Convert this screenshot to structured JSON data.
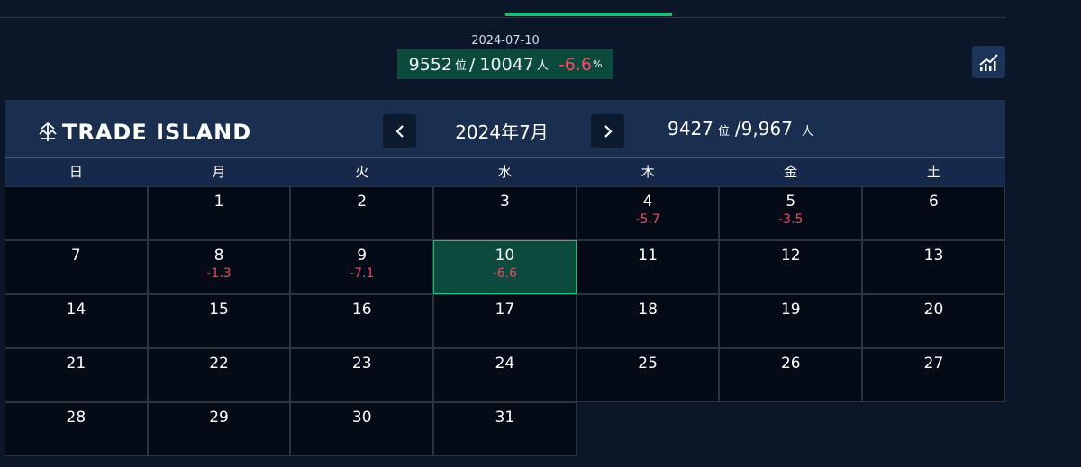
{
  "summary": {
    "date": "2024-07-10",
    "rank": "9552",
    "rank_unit": "位",
    "separator": "/",
    "total": "10047",
    "total_unit": "人",
    "change": "-6.6",
    "change_unit": "%"
  },
  "calendar": {
    "brand": "TRADE ISLAND",
    "month": "2024年7月",
    "rank": "9427",
    "rank_unit": "位",
    "total": "/9,967",
    "total_unit": "人",
    "weekdays": [
      "日",
      "月",
      "火",
      "水",
      "木",
      "金",
      "土"
    ],
    "days": [
      {
        "day": "",
        "val": ""
      },
      {
        "day": "1",
        "val": ""
      },
      {
        "day": "2",
        "val": ""
      },
      {
        "day": "3",
        "val": ""
      },
      {
        "day": "4",
        "val": "-5.7"
      },
      {
        "day": "5",
        "val": "-3.5"
      },
      {
        "day": "6",
        "val": ""
      },
      {
        "day": "7",
        "val": ""
      },
      {
        "day": "8",
        "val": "-1.3"
      },
      {
        "day": "9",
        "val": "-7.1"
      },
      {
        "day": "10",
        "val": "-6.6",
        "selected": true
      },
      {
        "day": "11",
        "val": ""
      },
      {
        "day": "12",
        "val": ""
      },
      {
        "day": "13",
        "val": ""
      },
      {
        "day": "14",
        "val": ""
      },
      {
        "day": "15",
        "val": ""
      },
      {
        "day": "16",
        "val": ""
      },
      {
        "day": "17",
        "val": ""
      },
      {
        "day": "18",
        "val": ""
      },
      {
        "day": "19",
        "val": ""
      },
      {
        "day": "20",
        "val": ""
      },
      {
        "day": "21",
        "val": ""
      },
      {
        "day": "22",
        "val": ""
      },
      {
        "day": "23",
        "val": ""
      },
      {
        "day": "24",
        "val": ""
      },
      {
        "day": "25",
        "val": ""
      },
      {
        "day": "26",
        "val": ""
      },
      {
        "day": "27",
        "val": ""
      },
      {
        "day": "28",
        "val": ""
      },
      {
        "day": "29",
        "val": ""
      },
      {
        "day": "30",
        "val": ""
      },
      {
        "day": "31",
        "val": ""
      }
    ]
  },
  "icons": {
    "chart": "chart-icon",
    "logo": "trade-island-logo-icon",
    "prev": "chevron-left-icon",
    "next": "chevron-right-icon"
  },
  "colors": {
    "background": "#0b1628",
    "accent_green": "#1fbf7a",
    "highlight_bg": "#0c4a3e",
    "negative": "#e8485f"
  }
}
